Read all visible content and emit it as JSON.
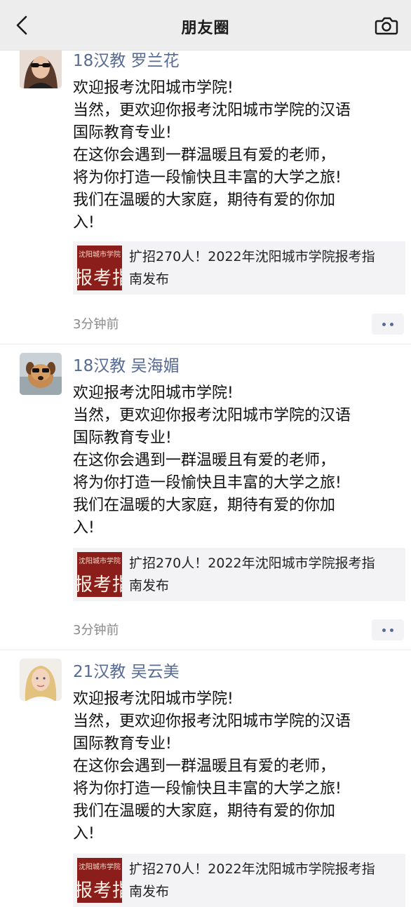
{
  "header": {
    "title": "朋友圈",
    "back_icon": "chevron-left-icon",
    "camera_icon": "camera-icon"
  },
  "colors": {
    "author_name": "#576b95",
    "topbar_bg": "#ededed",
    "card_bg": "#f3f3f5",
    "thumb_bg": "#8b1e1a"
  },
  "posts": [
    {
      "author": "18汉教 罗兰花",
      "lines": [
        "欢迎报考沈阳城市学院!",
        "当然，更欢迎你报考沈阳城市学院的汉语",
        "国际教育专业!",
        "在这你会遇到一群温暖且有爱的老师，",
        "将为你打造一段愉快且丰富的大学之旅!",
        "我们在温暖的大家庭，期待有爱的你加",
        "入!"
      ],
      "link": {
        "thumb_text": "报考指南",
        "lines": [
          "扩招270人！2022年沈阳城市学院报考指",
          "南发布"
        ]
      },
      "time": "3分钟前"
    },
    {
      "author": "18汉教 吴海媚",
      "lines": [
        "欢迎报考沈阳城市学院!",
        "当然，更欢迎你报考沈阳城市学院的汉语",
        "国际教育专业!",
        "在这你会遇到一群温暖且有爱的老师，",
        "将为你打造一段愉快且丰富的大学之旅!",
        "我们在温暖的大家庭，期待有爱的你加",
        "入!"
      ],
      "link": {
        "thumb_text": "报考指南",
        "lines": [
          "扩招270人！2022年沈阳城市学院报考指",
          "南发布"
        ]
      },
      "time": "3分钟前"
    },
    {
      "author": "21汉教 吴云美",
      "lines": [
        "欢迎报考沈阳城市学院!",
        "当然，更欢迎你报考沈阳城市学院的汉语",
        "国际教育专业!",
        "在这你会遇到一群温暖且有爱的老师，",
        "将为你打造一段愉快且丰富的大学之旅!",
        "我们在温暖的大家庭，期待有爱的你加",
        "入!"
      ],
      "link": {
        "thumb_text": "报考指南",
        "lines": [
          "扩招270人！2022年沈阳城市学院报考指",
          "南发布"
        ]
      }
    }
  ]
}
